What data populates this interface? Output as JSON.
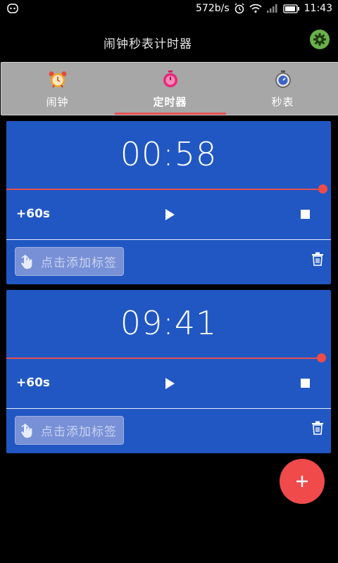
{
  "status_bar": {
    "speed": "572b/s",
    "time": "11:43"
  },
  "header": {
    "title": "闹钟秒表计时器"
  },
  "tabs": [
    {
      "label": "闹钟",
      "icon": "alarm-clock-icon",
      "active": false
    },
    {
      "label": "定时器",
      "icon": "timer-icon",
      "active": true
    },
    {
      "label": "秒表",
      "icon": "stopwatch-icon",
      "active": false
    }
  ],
  "timers": [
    {
      "time": "00:58",
      "add_label": "+60s",
      "tag_placeholder": "点击添加标签"
    },
    {
      "time": "09:41",
      "add_label": "+60s",
      "tag_placeholder": "点击添加标签"
    }
  ],
  "fab": {
    "label": "+"
  },
  "colors": {
    "card": "#2157c2",
    "accent": "#e55050",
    "tabs_bg": "#a7a7a7",
    "settings": "#6ab04c"
  }
}
